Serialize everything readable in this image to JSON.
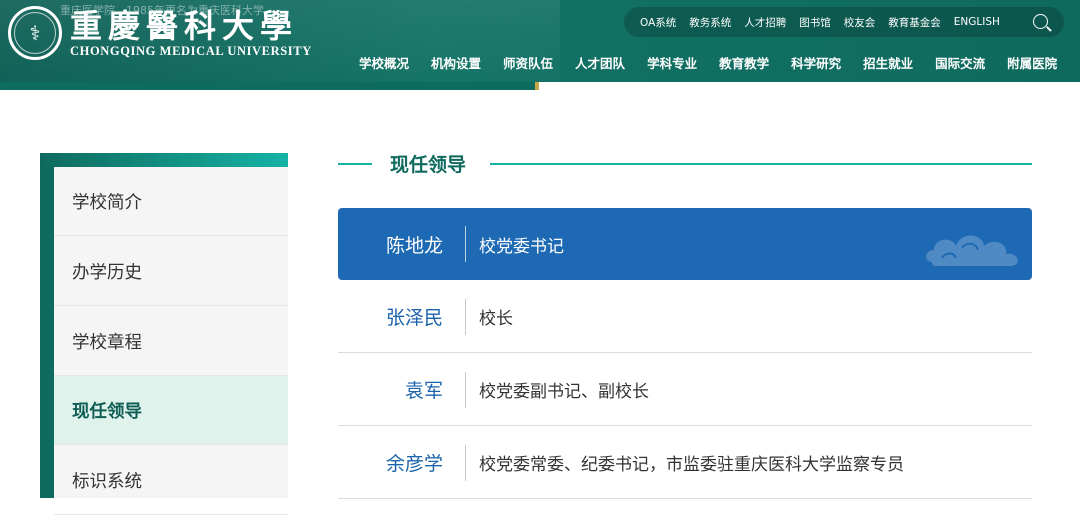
{
  "header": {
    "logo_cn": "重慶醫科大學",
    "logo_en": "CHONGQING MEDICAL UNIVERSITY",
    "emblem_icon": "university-seal-icon",
    "scroll_note": "重庆医学院　1985年更名为重庆医科大学",
    "toplinks": [
      "OA系统",
      "教务系统",
      "人才招聘",
      "图书馆",
      "校友会",
      "教育基金会",
      "ENGLISH"
    ],
    "search_icon": "search-icon",
    "nav": [
      "学校概况",
      "机构设置",
      "师资队伍",
      "人才团队",
      "学科专业",
      "教育教学",
      "科学研究",
      "招生就业",
      "国际交流",
      "附属医院"
    ]
  },
  "sidebar": {
    "items": [
      {
        "label": "学校简介",
        "active": false
      },
      {
        "label": "办学历史",
        "active": false
      },
      {
        "label": "学校章程",
        "active": false
      },
      {
        "label": "现任领导",
        "active": true
      },
      {
        "label": "标识系统",
        "active": false
      }
    ]
  },
  "content": {
    "section_title": "现任领导",
    "leaders": [
      {
        "name": "陈地龙",
        "title": "校党委书记",
        "highlight": true
      },
      {
        "name": "张泽民",
        "title": "校长",
        "highlight": false
      },
      {
        "name": "袁军",
        "title": "校党委副书记、副校长",
        "highlight": false
      },
      {
        "name": "余彦学",
        "title": "校党委常委、纪委书记，市监委驻重庆医科大学监察专员",
        "highlight": false
      }
    ],
    "decor_icon": "cloud-pattern-icon"
  },
  "colors": {
    "header_green": "#0f6a5e",
    "accent_teal": "#15b3a5",
    "highlight_blue": "#1e69b4",
    "name_blue": "#1b63ab",
    "active_bg": "#dff2ec"
  }
}
